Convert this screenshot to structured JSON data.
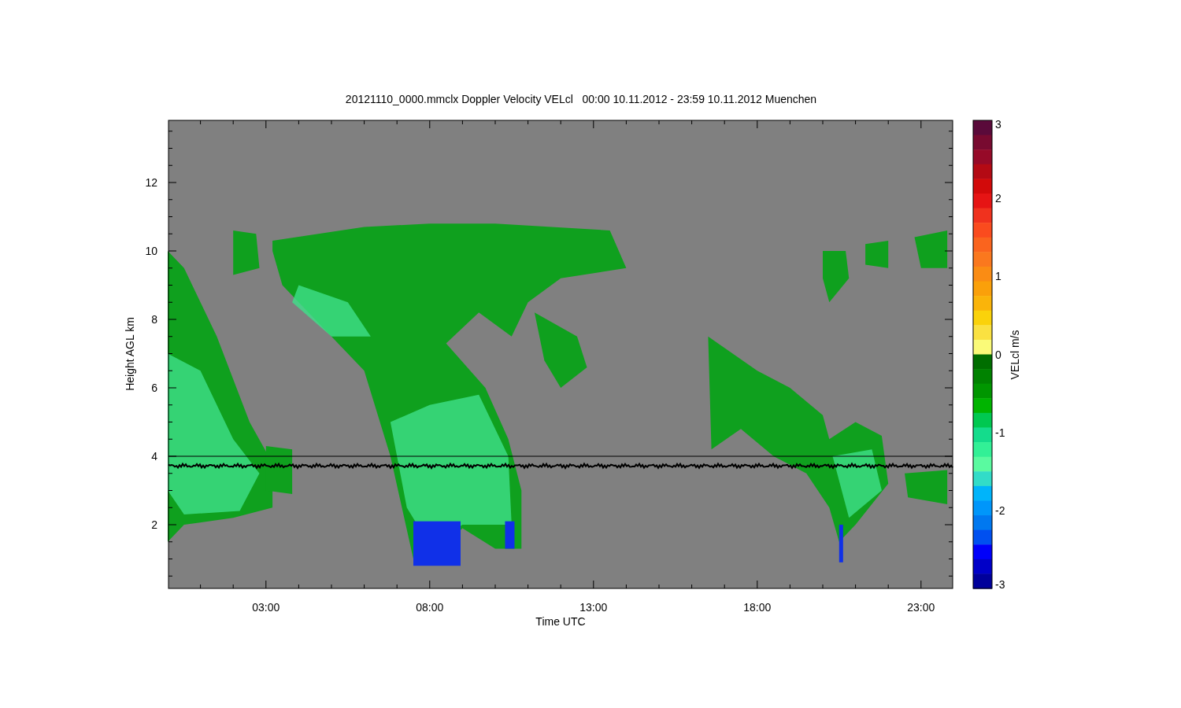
{
  "title": "20121110_0000.mmclx Doppler Velocity VELcl   00:00 10.11.2012 - 23:59 10.11.2012 Muenchen",
  "x_axis": {
    "label": "Time UTC",
    "ticks": [
      "03:00",
      "08:00",
      "13:00",
      "18:00",
      "23:00"
    ]
  },
  "y_axis": {
    "label": "Height AGL km",
    "ticks": [
      "12",
      "10",
      "8",
      "6",
      "4",
      "2"
    ]
  },
  "colorbar": {
    "label": "VELcl m/s",
    "ticks": [
      "3",
      "2",
      "1",
      "0",
      "-1",
      "-2",
      "-3"
    ]
  }
}
